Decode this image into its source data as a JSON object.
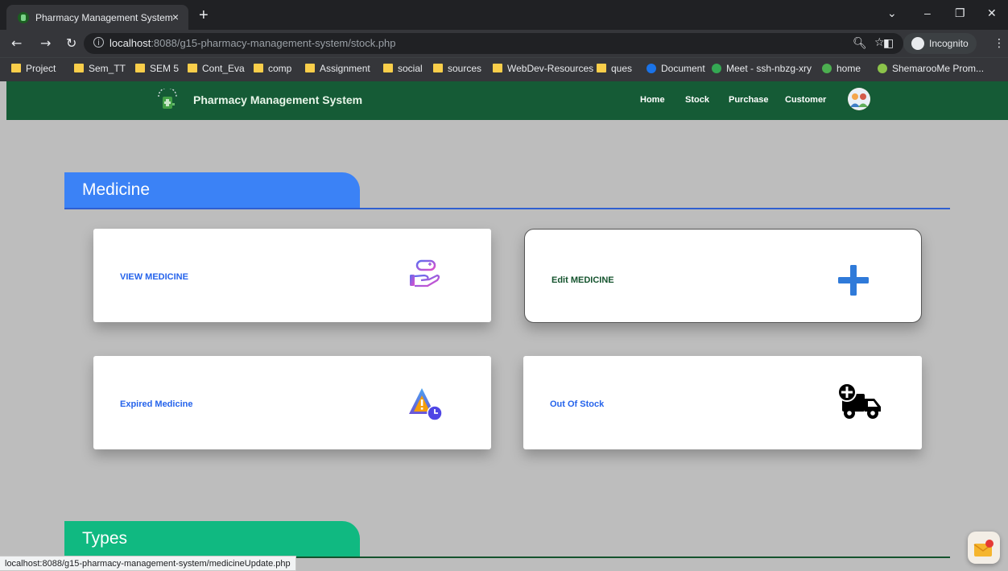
{
  "browser": {
    "tab_title": "Pharmacy Management System",
    "tab_close": "×",
    "new_tab": "+",
    "url_host": "localhost",
    "url_rest": ":8088/g15-pharmacy-management-system/stock.php",
    "incognito_label": "Incognito",
    "bookmarks": [
      {
        "label": "Project",
        "kind": "folder"
      },
      {
        "label": "Sem_TT",
        "kind": "folder"
      },
      {
        "label": "SEM 5",
        "kind": "folder"
      },
      {
        "label": "Cont_Eva",
        "kind": "folder"
      },
      {
        "label": "comp",
        "kind": "folder"
      },
      {
        "label": "Assignment",
        "kind": "folder"
      },
      {
        "label": "social",
        "kind": "folder"
      },
      {
        "label": "sources",
        "kind": "folder"
      },
      {
        "label": "WebDev-Resources",
        "kind": "folder"
      },
      {
        "label": "ques",
        "kind": "folder"
      },
      {
        "label": "Document",
        "kind": "site",
        "color": "#1a73e8"
      },
      {
        "label": "Meet - ssh-nbzg-xry",
        "kind": "site",
        "color": "#34a853"
      },
      {
        "label": "home",
        "kind": "site",
        "color": "#4caf50"
      },
      {
        "label": "ShemarooMe Prom...",
        "kind": "site",
        "color": "#8bc34a"
      }
    ],
    "status_url": "localhost:8088/g15-pharmacy-management-system/medicineUpdate.php"
  },
  "nav": {
    "brand": "Pharmacy Management System",
    "links": [
      "Home",
      "Stock",
      "Purchase",
      "Customer"
    ],
    "brand_color": "#155b36"
  },
  "sections": {
    "medicine": {
      "title": "Medicine",
      "color": "#3b82f6"
    },
    "types": {
      "title": "Types",
      "color": "#10b981"
    }
  },
  "cards": {
    "view": {
      "label": "VIEW MEDICINE",
      "icon": "pill-hand-icon"
    },
    "edit": {
      "label": "Edit MEDICINE",
      "icon": "plus-icon"
    },
    "expired": {
      "label": "Expired Medicine",
      "icon": "warning-clock-icon"
    },
    "out_of_stock": {
      "label": "Out Of Stock",
      "icon": "delivery-truck-plus-icon"
    }
  }
}
